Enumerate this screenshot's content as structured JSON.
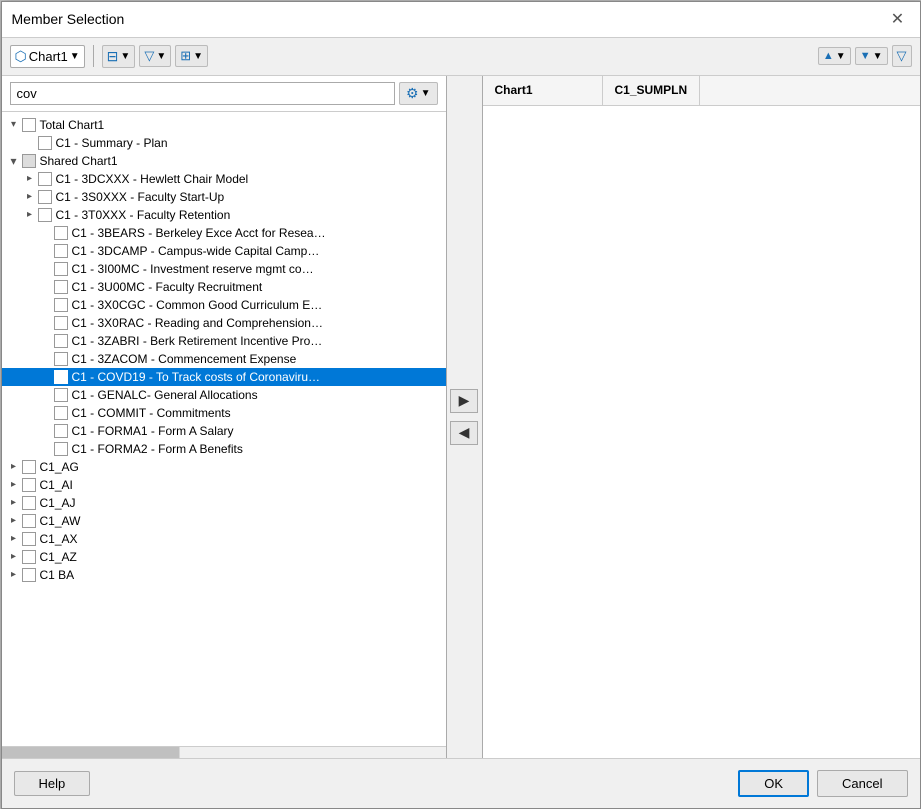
{
  "dialog": {
    "title": "Member Selection",
    "close_label": "✕"
  },
  "toolbar": {
    "chart_label": "Chart1",
    "list_icon": "≡",
    "filter_icon": "▼",
    "grid_icon": "⊞",
    "up_icon": "▲",
    "down_icon": "▼",
    "filter2_icon": "▼"
  },
  "search": {
    "value": "cov",
    "placeholder": ""
  },
  "tree": {
    "items": [
      {
        "id": "total",
        "label": "Total Chart1",
        "indent": 0,
        "expand": "expanded",
        "checkbox": "empty",
        "selected": false
      },
      {
        "id": "c1-summary",
        "label": "C1 - Summary - Plan",
        "indent": 1,
        "expand": "leaf",
        "checkbox": "empty",
        "selected": false
      },
      {
        "id": "shared",
        "label": "Shared Chart1",
        "indent": 1,
        "expand": "expanded",
        "checkbox": "empty",
        "selected": false
      },
      {
        "id": "c1-3dcxxx",
        "label": "C1 - 3DCXXX - Hewlett Chair Model",
        "indent": 2,
        "expand": "collapsed",
        "checkbox": "empty",
        "selected": false
      },
      {
        "id": "c1-3s0xxx",
        "label": "C1 - 3S0XXX - Faculty Start-Up",
        "indent": 2,
        "expand": "collapsed",
        "checkbox": "empty",
        "selected": false
      },
      {
        "id": "c1-3t0xxx",
        "label": "C1 - 3T0XXX - Faculty Retention",
        "indent": 2,
        "expand": "collapsed",
        "checkbox": "empty",
        "selected": false
      },
      {
        "id": "c1-3bears",
        "label": "C1 - 3BEARS - Berkeley Exce Acct for Resea…",
        "indent": 2,
        "expand": "leaf",
        "checkbox": "empty",
        "selected": false
      },
      {
        "id": "c1-3dcamp",
        "label": "C1 - 3DCAMP - Campus-wide Capital Camp…",
        "indent": 2,
        "expand": "leaf",
        "checkbox": "empty",
        "selected": false
      },
      {
        "id": "c1-3i00mc",
        "label": "C1 - 3I00MC - Investment reserve mgmt co…",
        "indent": 2,
        "expand": "leaf",
        "checkbox": "empty",
        "selected": false
      },
      {
        "id": "c1-3u00mc",
        "label": "C1 - 3U00MC - Faculty Recruitment",
        "indent": 2,
        "expand": "leaf",
        "checkbox": "empty",
        "selected": false
      },
      {
        "id": "c1-3x0cgc",
        "label": "C1 - 3X0CGC - Common Good Curriculum E…",
        "indent": 2,
        "expand": "leaf",
        "checkbox": "empty",
        "selected": false
      },
      {
        "id": "c1-3x0rac",
        "label": "C1 - 3X0RAC - Reading and Comprehension…",
        "indent": 2,
        "expand": "leaf",
        "checkbox": "empty",
        "selected": false
      },
      {
        "id": "c1-3zabri",
        "label": "C1 - 3ZABRI - Berk Retirement Incentive Pro…",
        "indent": 2,
        "expand": "leaf",
        "checkbox": "empty",
        "selected": false
      },
      {
        "id": "c1-3zacom",
        "label": "C1 - 3ZACOM - Commencement Expense",
        "indent": 2,
        "expand": "leaf",
        "checkbox": "empty",
        "selected": false
      },
      {
        "id": "c1-covd19",
        "label": "C1 - COVD19 - To Track costs of Coronaviru…",
        "indent": 2,
        "expand": "leaf",
        "checkbox": "empty",
        "selected": true
      },
      {
        "id": "c1-genalc",
        "label": "C1 - GENALC- General Allocations",
        "indent": 2,
        "expand": "leaf",
        "checkbox": "empty",
        "selected": false
      },
      {
        "id": "c1-commit",
        "label": "C1 - COMMIT - Commitments",
        "indent": 2,
        "expand": "leaf",
        "checkbox": "empty",
        "selected": false
      },
      {
        "id": "c1-forma1",
        "label": "C1 - FORMA1 - Form A Salary",
        "indent": 2,
        "expand": "leaf",
        "checkbox": "empty",
        "selected": false
      },
      {
        "id": "c1-forma2",
        "label": "C1 - FORMA2 - Form A Benefits",
        "indent": 2,
        "expand": "leaf",
        "checkbox": "empty",
        "selected": false
      },
      {
        "id": "c1-ag",
        "label": "C1_AG",
        "indent": 1,
        "expand": "collapsed",
        "checkbox": "empty",
        "selected": false
      },
      {
        "id": "c1-ai",
        "label": "C1_AI",
        "indent": 1,
        "expand": "collapsed",
        "checkbox": "empty",
        "selected": false
      },
      {
        "id": "c1-aj",
        "label": "C1_AJ",
        "indent": 1,
        "expand": "collapsed",
        "checkbox": "empty",
        "selected": false
      },
      {
        "id": "c1-aw",
        "label": "C1_AW",
        "indent": 1,
        "expand": "collapsed",
        "checkbox": "empty",
        "selected": false
      },
      {
        "id": "c1-ax",
        "label": "C1_AX",
        "indent": 1,
        "expand": "collapsed",
        "checkbox": "empty",
        "selected": false
      },
      {
        "id": "c1-az",
        "label": "C1_AZ",
        "indent": 1,
        "expand": "collapsed",
        "checkbox": "empty",
        "selected": false
      },
      {
        "id": "c1-ba",
        "label": "C1  BA",
        "indent": 1,
        "expand": "collapsed",
        "checkbox": "empty",
        "selected": false
      }
    ]
  },
  "right_panel": {
    "col1_header": "Chart1",
    "col2_header": "C1_SUMPLN"
  },
  "arrows": {
    "right_label": "▶",
    "left_label": "◀"
  },
  "buttons": {
    "help": "Help",
    "ok": "OK",
    "cancel": "Cancel"
  }
}
